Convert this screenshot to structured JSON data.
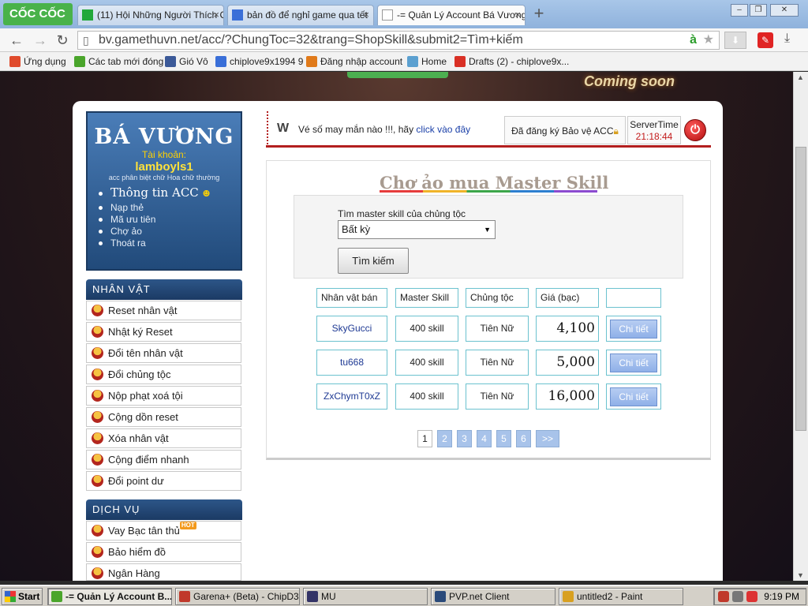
{
  "browser": {
    "brand": "CỐC CỐC",
    "tabs": [
      {
        "label": "(11) Hội Những Người Thích C",
        "color": "#22a83a"
      },
      {
        "label": "bản đồ để nghỉ game qua tết",
        "color": "#3a6fd8"
      },
      {
        "label": "-= Quản Lý Account Bá Vương",
        "color": "#888888"
      }
    ],
    "new_tab_icon": "plus-icon",
    "url": "bv.gamethuvn.net/acc/?ChungToc=32&trang=ShopSkill&submit2=Tìm+kiếm",
    "bookmarks": [
      {
        "label": "Ứng dụng",
        "color": "#e04b2c"
      },
      {
        "label": "Các tab mới đóng",
        "color": "#4aa52b"
      },
      {
        "label": "Gió Vô",
        "color": "#3b5998"
      },
      {
        "label": "chiplove9x1994 9",
        "color": "#3a6fd8"
      },
      {
        "label": "Đăng nhập account",
        "color": "#e07a1a"
      },
      {
        "label": "Home",
        "color": "#5ba0d0"
      },
      {
        "label": "Drafts (2) - chiplove9x...",
        "color": "#d93025"
      }
    ]
  },
  "banner": {
    "coming_soon": "Coming soon"
  },
  "user": {
    "brand": "BÁ VƯƠNG",
    "account_label": "Tài khoản:",
    "account_name": "lamboyls1",
    "note": "acc phân biệt chữ Hoa chữ thường",
    "menu": [
      "Thông tin ACC",
      "Nạp thẻ",
      "Mã ưu tiên",
      "Chợ ảo",
      "Thoát ra"
    ]
  },
  "sections": {
    "character": {
      "title": "NHÂN VẬT",
      "items": [
        "Reset nhân vật",
        "Nhật ký Reset",
        "Đổi tên nhân vật",
        "Đổi chủng tộc",
        "Nộp phạt xoá tội",
        "Cộng dồn reset",
        "Xóa nhân vật",
        "Cộng điểm nhanh",
        "Đổi point dư"
      ]
    },
    "services": {
      "title": "DỊCH VỤ",
      "items": [
        "Vay Bạc tân thủ",
        "Bảo hiểm đồ",
        "Ngân Hàng"
      ],
      "hot_badge": "HOT"
    }
  },
  "topbar": {
    "lucky_text": "Vé số may mắn nào !!!, hãy ",
    "lucky_link": "click vào đây",
    "protect": "Đã đăng ký Bảo vệ ACC",
    "server_time_label": "ServerTime",
    "server_time": "21:18:44"
  },
  "shop": {
    "title": "Chợ ảo mua Master Skill",
    "search_label": "Tìm master skill của chủng tộc",
    "select_value": "Bất kỳ",
    "search_button": "Tìm kiếm",
    "headers": [
      "Nhân vật bán",
      "Master Skill",
      "Chủng tộc",
      "Giá (bạc)",
      ""
    ],
    "rows": [
      {
        "seller": "SkyGucci",
        "skill": "400 skill",
        "race": "Tiên Nữ",
        "price": "4,100",
        "action": "Chi tiết"
      },
      {
        "seller": "tu668",
        "skill": "400 skill",
        "race": "Tiên Nữ",
        "price": "5,000",
        "action": "Chi tiết"
      },
      {
        "seller": "ZxChymT0xZ",
        "skill": "400 skill",
        "race": "Tiên Nữ",
        "price": "16,000",
        "action": "Chi tiết"
      }
    ],
    "pages": [
      "1",
      "2",
      "3",
      "4",
      "5",
      "6",
      ">>"
    ],
    "current_page": "1"
  },
  "taskbar": {
    "start": "Start",
    "items": [
      {
        "label": "-= Quản Lý Account B...",
        "color": "#4aa52b"
      },
      {
        "label": "Garena+ (Beta) - ChipD3...",
        "color": "#c0392b"
      },
      {
        "label": "MU",
        "color": "#333366"
      },
      {
        "label": "PVP.net Client",
        "color": "#2a4a7a"
      },
      {
        "label": "untitled2 - Paint",
        "color": "#d8a020"
      }
    ],
    "clock": "9:19 PM"
  }
}
